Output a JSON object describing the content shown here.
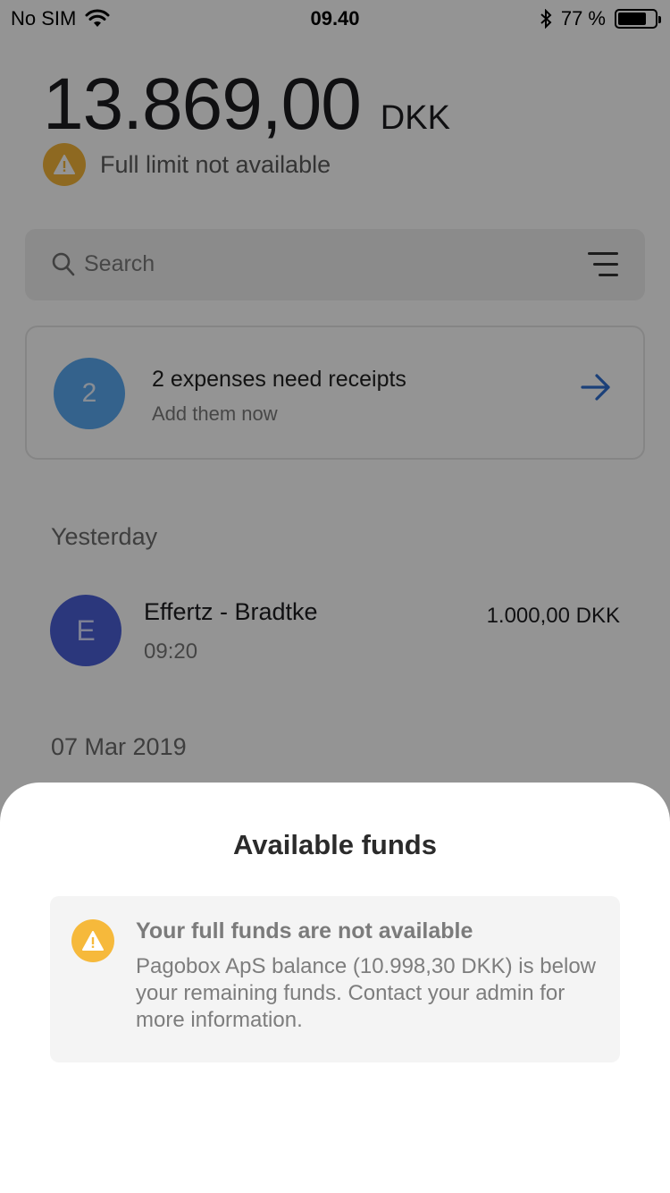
{
  "status_bar": {
    "carrier": "No SIM",
    "time": "09.40",
    "battery": "77 %",
    "battery_level": 0.77
  },
  "balance": {
    "amount": "13.869,00",
    "currency": "DKK",
    "limit_warning": "Full limit not available"
  },
  "search": {
    "placeholder": "Search"
  },
  "receipts_card": {
    "count": "2",
    "title": "2 expenses need receipts",
    "subtitle": "Add them now"
  },
  "sections": [
    {
      "label": "Yesterday",
      "transactions": [
        {
          "initial": "E",
          "name": "Effertz - Bradtke",
          "time": "09:20",
          "amount": "1.000,00 DKK"
        }
      ]
    },
    {
      "label": "07 Mar 2019"
    }
  ],
  "sheet": {
    "title": "Available funds",
    "notice_title": "Your full funds are not available",
    "notice_body": "Pagobox ApS balance (10.998,30 DKK) is below your remaining funds. Contact your admin for more information."
  },
  "colors": {
    "warning": "#f6b93b",
    "receipts_badge": "#5aa9f2",
    "avatar": "#4b5fd6",
    "arrow": "#2f6fd1",
    "overlay": "rgba(0,0,0,0.42)"
  }
}
